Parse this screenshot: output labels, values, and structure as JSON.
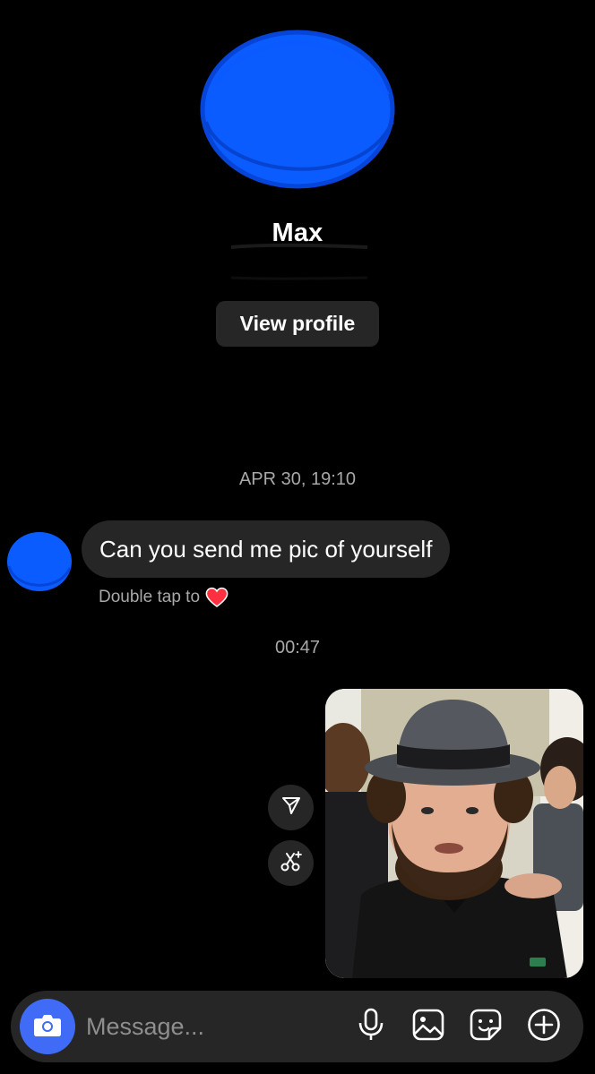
{
  "profile": {
    "name": "Max",
    "view_profile_label": "View profile",
    "avatar_color": "#0a5cff"
  },
  "conversation": {
    "timestamp_1": "APR 30, 19:10",
    "incoming_message": "Can you send me pic of yourself",
    "double_tap_hint": "Double tap to",
    "timestamp_2": "00:47"
  },
  "icons": {
    "share": "paper-plane-icon",
    "remix": "remix-scissors-icon",
    "camera": "camera-icon",
    "mic": "microphone-icon",
    "gallery": "image-gallery-icon",
    "sticker": "sticker-icon",
    "plus": "plus-circle-icon",
    "heart": "heart-icon"
  },
  "composer": {
    "placeholder": "Message..."
  },
  "colors": {
    "background": "#000000",
    "bubble": "#262626",
    "camera_accent": "#3f6bf6",
    "heart": "#ff3040",
    "muted_text": "#a8a8a8"
  }
}
